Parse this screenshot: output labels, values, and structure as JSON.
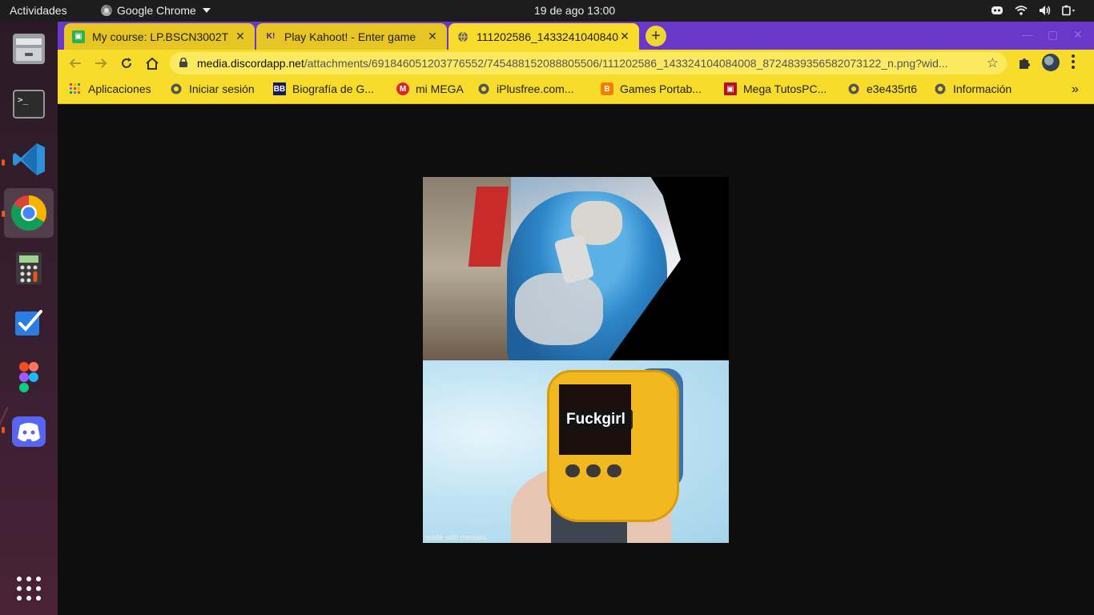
{
  "topbar": {
    "activities": "Actividades",
    "app_name": "Google Chrome",
    "clock": "19 de ago  13:00"
  },
  "dock": {
    "apps": [
      "files",
      "terminal",
      "vscode",
      "chrome",
      "calculator",
      "tasks",
      "figma",
      "discord",
      "show-applications"
    ],
    "active_app": "chrome"
  },
  "chrome": {
    "tabs": [
      {
        "title": "My course: LP.BSCN3002T",
        "favicon": "course-icon"
      },
      {
        "title": "Play Kahoot! - Enter game",
        "favicon": "kahoot-icon"
      },
      {
        "title": "111202586_1433241040840",
        "favicon": "globe-icon"
      }
    ],
    "active_tab_index": 2,
    "omnibox": {
      "host": "media.discordapp.net",
      "path": "/attachments/691846051203776552/745488152088805506/111202586_143324104084008_8724839356582073122_n.png?wid..."
    },
    "bookmarks": [
      {
        "label": "Aplicaciones",
        "icon": "apps-grid-icon"
      },
      {
        "label": "Iniciar sesión",
        "icon": "globe-icon"
      },
      {
        "label": "Biografía de G...",
        "icon": "bb-icon"
      },
      {
        "label": "mi MEGA",
        "icon": "mega-icon"
      },
      {
        "label": "iPlusfree.com...",
        "icon": "globe-icon"
      },
      {
        "label": "Games Portab...",
        "icon": "blogger-icon"
      },
      {
        "label": "Mega TutosPC...",
        "icon": "tutospc-icon"
      },
      {
        "label": "e3e435rt6",
        "icon": "globe-icon"
      },
      {
        "label": "Información",
        "icon": "globe-icon"
      }
    ],
    "bookmarks_overflow": "»"
  },
  "content": {
    "meme_caption": "Fuckgirl",
    "watermark": "made with mematic"
  },
  "colors": {
    "tabstrip": "#6a38c9",
    "theme_yellow": "#f7dc2b",
    "viewport_bg": "#0e0e0e",
    "dock": "#2b1a26",
    "topbar": "#1d1d1d"
  }
}
